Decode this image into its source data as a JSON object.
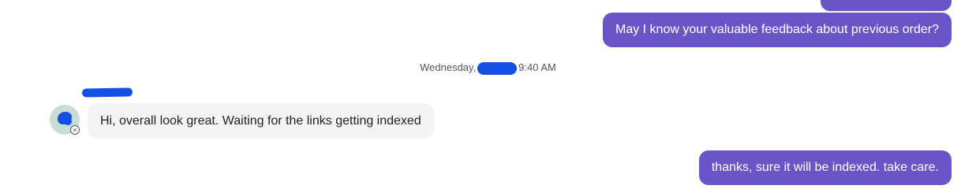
{
  "messages": [
    {
      "direction": "outgoing",
      "text": "May I know your valuable feedback about previous order?"
    },
    {
      "direction": "incoming",
      "text": "Hi, overall look great. Waiting for the links getting indexed"
    },
    {
      "direction": "outgoing",
      "text": "thanks, sure it will be indexed. take care."
    }
  ],
  "divider": {
    "day": "Wednesday,",
    "time": "9:40 AM"
  },
  "avatar": {
    "status_icon": "close-circle-icon",
    "status_glyph": "×"
  },
  "colors": {
    "outgoing_bubble": "#6a55c8",
    "incoming_bubble": "#f4f4f4",
    "redaction": "#1450e6",
    "avatar_bg": "#c8ddd4"
  }
}
